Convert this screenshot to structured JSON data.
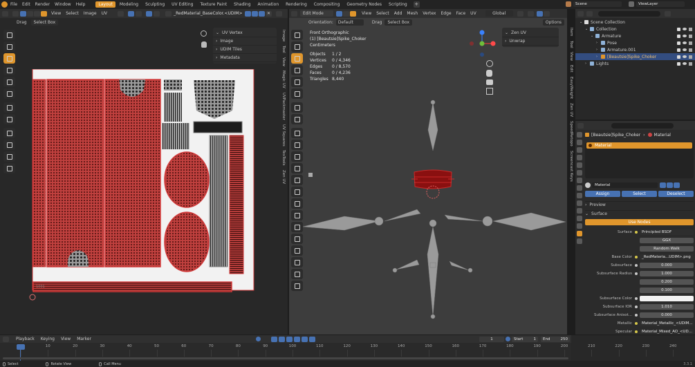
{
  "topbar": {
    "menus": [
      "File",
      "Edit",
      "Render",
      "Window",
      "Help"
    ],
    "workspaces": [
      "Layout",
      "Modeling",
      "Sculpting",
      "UV Editing",
      "Texture Paint",
      "Shading",
      "Animation",
      "Rendering",
      "Compositing",
      "Geometry Nodes",
      "Scripting"
    ],
    "active_workspace": "Layout",
    "scene": "Scene",
    "view_layer": "ViewLayer"
  },
  "uv_editor": {
    "menus": [
      "View",
      "Select",
      "Image",
      "UV"
    ],
    "image_name": "_RedMaterial_BaseColor.<UDIM>.png",
    "drag_label": "Drag",
    "select_mode": "Select Box",
    "sections": [
      "UV Vertex",
      "Image",
      "UDIM Tiles",
      "Metadata"
    ],
    "tabs": [
      "Image",
      "Tool",
      "View",
      "Magic UV",
      "UVPackmaster",
      "UV Squares",
      "TexTools",
      "Zen UV"
    ],
    "tile_label": "1001"
  },
  "viewport": {
    "mode": "Edit Mode",
    "menus": [
      "View",
      "Select",
      "Add",
      "Mesh",
      "Vertex",
      "Edge",
      "Face",
      "UV"
    ],
    "transform": "Global",
    "orientation_label": "Orientation:",
    "orientation_value": "Default",
    "drag_label": "Drag",
    "select_mode": "Select Box",
    "options": "Options",
    "overlay_title": "Front Orthographic",
    "overlay_object": "(1) [Beautsie]Spike_Choker",
    "overlay_units": "Centimeters",
    "stats": [
      {
        "label": "Objects",
        "value": "1 / 2"
      },
      {
        "label": "Vertices",
        "value": "0 / 4,346"
      },
      {
        "label": "Edges",
        "value": "0 / 8,570"
      },
      {
        "label": "Faces",
        "value": "0 / 4,236"
      },
      {
        "label": "Triangles",
        "value": "8,440"
      }
    ],
    "panel_sections": [
      "Zen UV",
      "Unwrap"
    ],
    "side_tabs": [
      "Item",
      "Tool",
      "View",
      "Edit",
      "EasyWeight",
      "Zen UV",
      "SpeedRetopo",
      "Screencast Keys"
    ]
  },
  "outliner": {
    "items": [
      {
        "label": "Scene Collection",
        "depth": 0
      },
      {
        "label": "Collection",
        "depth": 1
      },
      {
        "label": "Armature",
        "depth": 2
      },
      {
        "label": "Pose",
        "depth": 3
      },
      {
        "label": "Armature.001",
        "depth": 3
      },
      {
        "label": "[Beautsie]Spike_Choker",
        "depth": 3,
        "selected": true
      },
      {
        "label": "Lights",
        "depth": 1
      }
    ]
  },
  "properties": {
    "breadcrumb_object": "[Beautsie]Spike_Choker",
    "breadcrumb_data": "Material",
    "slot": "Material",
    "material_name": "Material",
    "assign": "Assign",
    "select": "Select",
    "deselect": "Deselect",
    "preview": "Preview",
    "surface": "Surface",
    "use_nodes": "Use Nodes",
    "rows": [
      {
        "label": "Surface",
        "value": "Principled BSDF"
      },
      {
        "label": "",
        "value": "GGX"
      },
      {
        "label": "",
        "value": "Random Walk"
      },
      {
        "label": "Base Color",
        "value": "_RedMateria...UDIM>.png"
      },
      {
        "label": "Subsurface",
        "value": "0.000"
      },
      {
        "label": "Subsurface Radius",
        "value": "1.000"
      },
      {
        "label": "",
        "value": "0.200"
      },
      {
        "label": "",
        "value": "0.100"
      },
      {
        "label": "Subsurface Color",
        "value": ""
      },
      {
        "label": "Subsurface IOR",
        "value": "1.010"
      },
      {
        "label": "Subsurface Anisot...",
        "value": "0.000"
      },
      {
        "label": "Metallic",
        "value": "Material_Metallic_<UDIM..."
      },
      {
        "label": "Specular",
        "value": "Material_Mixed_AO_<UD..."
      },
      {
        "label": "Specular Tint",
        "value": "0.000"
      },
      {
        "label": "Roughness",
        "value": "Material_Ro...<UDIM..."
      }
    ]
  },
  "timeline": {
    "menus": [
      "Playback",
      "Keying",
      "View",
      "Marker"
    ],
    "current_frame": "1",
    "start_label": "Start",
    "start": "1",
    "end_label": "End",
    "end": "250",
    "ticks": [
      "0",
      "10",
      "20",
      "30",
      "40",
      "50",
      "60",
      "70",
      "80",
      "90",
      "100",
      "110",
      "120",
      "130",
      "140",
      "150",
      "160",
      "170",
      "180",
      "190",
      "200",
      "210",
      "220",
      "230",
      "240",
      "250"
    ]
  },
  "statusbar": {
    "items": [
      "Select",
      "Rotate View",
      "Call Menu"
    ],
    "version": "3.3.1"
  },
  "colors": {
    "accent": "#e0962c",
    "blue": "#4772b3",
    "uv_red": "#c94a48",
    "edit_red": "#b02020"
  }
}
